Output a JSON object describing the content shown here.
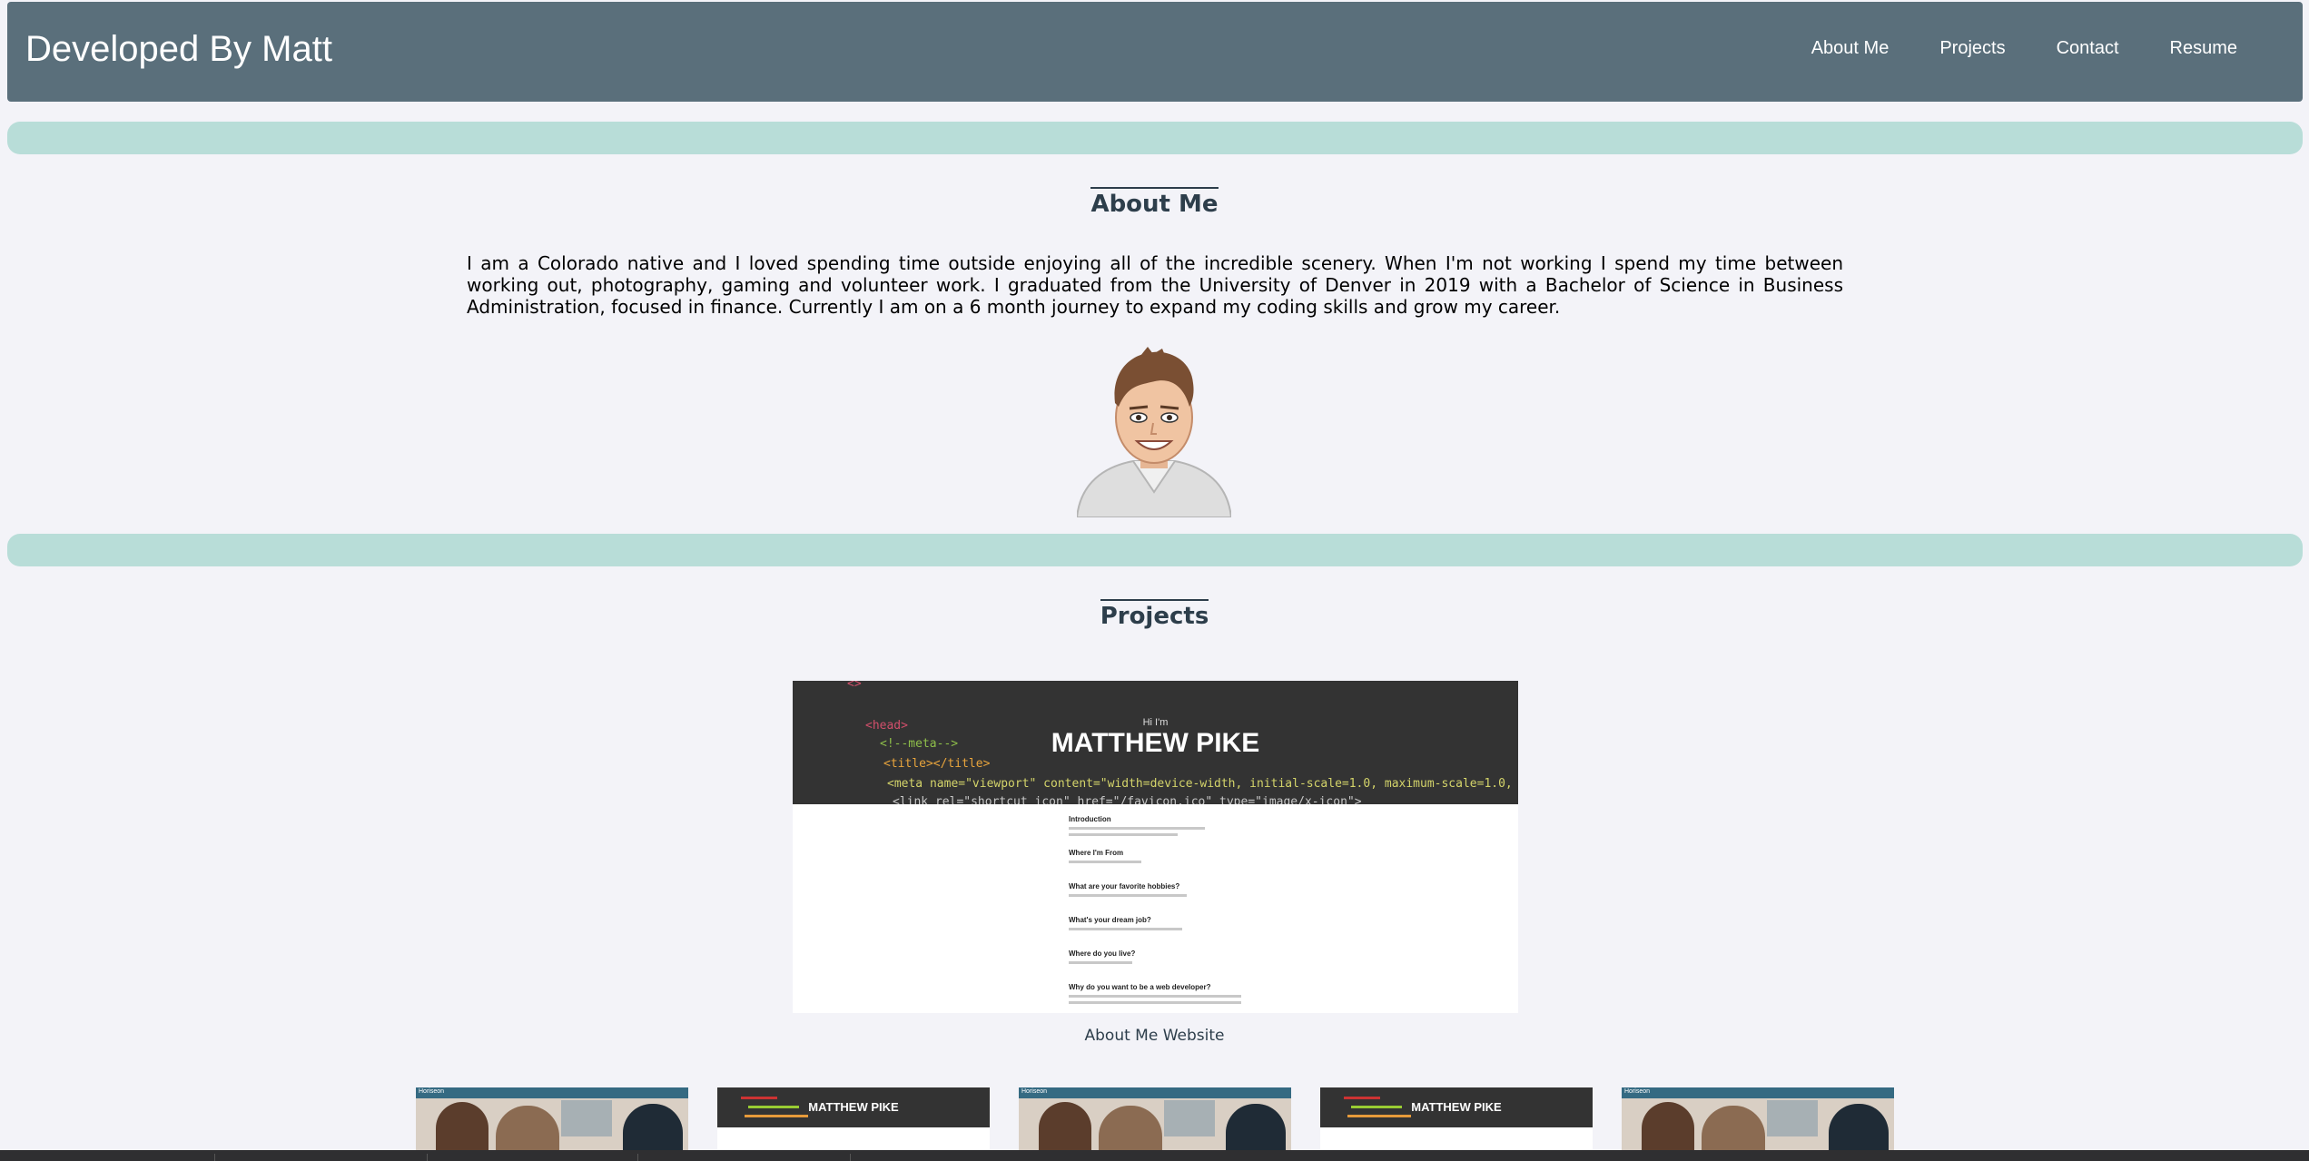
{
  "header": {
    "brand": "Developed By Matt",
    "nav": [
      "About Me",
      "Projects",
      "Contact",
      "Resume"
    ]
  },
  "about": {
    "title": "About Me",
    "text": "I am a Colorado native and I loved spending time outside enjoying all of the incredible scenery. When I'm not working I spend my time between working out, photography, gaming and volunteer work. I graduated from the University of Denver in 2019 with a Bachelor of Science in Business Administration, focused in finance. Currently I am on a 6 month journey to expand my coding skills and grow my career.",
    "avatar_icon": "cartoon-avatar-icon"
  },
  "projects": {
    "title": "Projects",
    "featured": {
      "greeting": "Hi I'm",
      "name": "MATTHEW PIKE",
      "questions": [
        "Introduction",
        "Where I'm From",
        "What are your favorite hobbies?",
        "What's your dream job?",
        "Where do you live?",
        "Why do you want to be a web developer?"
      ],
      "caption": "About Me Website"
    },
    "thumbnails": [
      {
        "type": "team-photo",
        "label": "Horiseon"
      },
      {
        "type": "about-me",
        "label": "MATTHEW PIKE"
      },
      {
        "type": "team-photo",
        "label": "Horiseon"
      },
      {
        "type": "about-me",
        "label": "MATTHEW PIKE"
      },
      {
        "type": "team-photo",
        "label": "Horiseon"
      }
    ]
  },
  "colors": {
    "header_bg": "#5a6f7b",
    "divider": "#b8ddd8",
    "page_bg": "#f3f3f8",
    "heading": "#2d3e4b"
  }
}
